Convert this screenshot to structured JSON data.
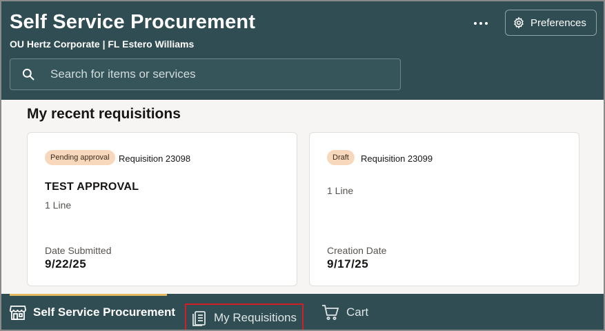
{
  "header": {
    "title": "Self Service Procurement",
    "subtitle": "OU Hertz Corporate | FL Estero Williams",
    "preferences_label": "Preferences"
  },
  "search": {
    "placeholder": "Search for items or services",
    "value": ""
  },
  "recent": {
    "title": "My recent requisitions",
    "cards": [
      {
        "status": "Pending approval",
        "requisition": "Requisition 23098",
        "name": "TEST APPROVAL",
        "lines": "1 Line",
        "date_label": "Date Submitted",
        "date_value": "9/22/25"
      },
      {
        "status": "Draft",
        "requisition": "Requisition 23099",
        "lines": "1 Line",
        "date_label": "Creation Date",
        "date_value": "9/17/25"
      }
    ]
  },
  "nav": {
    "home": "Self Service Procurement",
    "requisitions": "My Requisitions",
    "cart": "Cart"
  },
  "colors": {
    "header_bg": "#2f4d52",
    "badge_bg": "#f8d8bd",
    "active_indicator": "#e2b95f",
    "highlight_border": "#d21f26"
  }
}
